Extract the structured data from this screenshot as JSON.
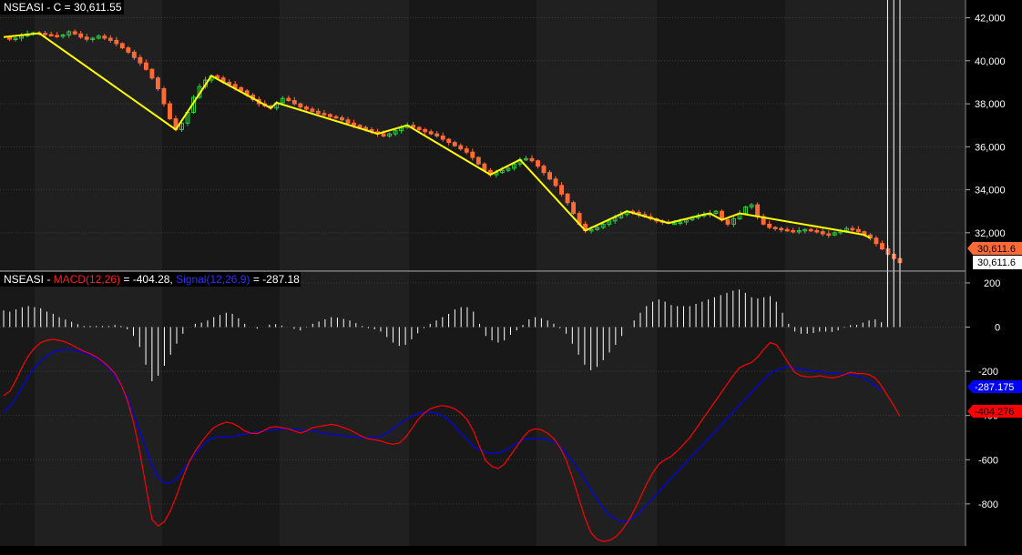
{
  "price_pane": {
    "title": "NSEASI - C = 30,611.55",
    "last_price_tag": "30,611.6",
    "last_price_tag_2": "30,611.6",
    "colors": {
      "up": "#2ecc40",
      "down": "#ff6a36",
      "zigzag": "#ffff00"
    }
  },
  "macd_pane": {
    "title_prefix": "NSEASI - ",
    "macd_label": "MACD(12,26)",
    "macd_value": " = -404.28, ",
    "signal_label": "Signal(12,26,9)",
    "signal_value": " = -287.18",
    "signal_tag": "-287.175",
    "macd_tag": "-404.276",
    "colors": {
      "macd": "#ff0000",
      "signal": "#0000ff",
      "histogram": "#ffffff"
    }
  },
  "chart_data": [
    {
      "type": "candlestick",
      "title": "NSEASI - C = 30,611.55",
      "y_ticks": [
        "42,000",
        "40,000",
        "38,000",
        "36,000",
        "34,000",
        "32,000"
      ],
      "ylim": [
        30300,
        42700
      ],
      "bars": 165,
      "closes": [
        41100,
        41000,
        41050,
        41150,
        41250,
        41300,
        41280,
        41220,
        41180,
        41150,
        41200,
        41350,
        41250,
        41100,
        41000,
        41050,
        41150,
        41050,
        40950,
        40800,
        40600,
        40400,
        40150,
        39900,
        39600,
        39200,
        38700,
        38000,
        37300,
        36800,
        37100,
        37600,
        38300,
        38800,
        39100,
        39300,
        39200,
        39000,
        38900,
        38750,
        38600,
        38400,
        38200,
        38000,
        37900,
        37800,
        38050,
        38250,
        38150,
        38000,
        37850,
        37750,
        37650,
        37550,
        37500,
        37400,
        37350,
        37250,
        37100,
        37000,
        36900,
        36800,
        36700,
        36600,
        36500,
        36600,
        36750,
        36900,
        37000,
        36900,
        36800,
        36700,
        36600,
        36500,
        36350,
        36200,
        36050,
        35900,
        35750,
        35500,
        35200,
        34900,
        34700,
        34800,
        34900,
        35000,
        35200,
        35400,
        35450,
        35350,
        35100,
        34800,
        34500,
        34200,
        33800,
        33400,
        32900,
        32400,
        32100,
        32150,
        32250,
        32400,
        32550,
        32700,
        32850,
        33000,
        32950,
        32850,
        32750,
        32650,
        32550,
        32500,
        32450,
        32450,
        32500,
        32600,
        32700,
        32800,
        32850,
        32900,
        33000,
        32600,
        32400,
        32650,
        32900,
        33200,
        33300,
        32750,
        32400,
        32250,
        32200,
        32150,
        32100,
        32050,
        32100,
        32150,
        32100,
        32050,
        31950,
        31900,
        32000,
        32100,
        32200,
        32150,
        32050,
        31900,
        31750,
        31500,
        31250,
        31000,
        30800,
        30611.55
      ],
      "zigzag_labels": []
    },
    {
      "type": "line",
      "title": "NSEASI - MACD(12,26) = -404.28, Signal(12,26,9) = -287.18",
      "y_ticks": [
        "200",
        "0",
        "-200",
        "-400",
        "-600",
        "-800"
      ],
      "ylim": [
        -990,
        245
      ],
      "series": [
        {
          "name": "MACD(12,26)",
          "values": [
            -310,
            -290,
            -240,
            -180,
            -130,
            -95,
            -70,
            -60,
            -55,
            -60,
            -68,
            -80,
            -95,
            -110,
            -120,
            -135,
            -155,
            -180,
            -210,
            -260,
            -330,
            -430,
            -560,
            -720,
            -870,
            -900,
            -880,
            -830,
            -760,
            -680,
            -610,
            -560,
            -520,
            -485,
            -455,
            -440,
            -430,
            -435,
            -450,
            -470,
            -480,
            -482,
            -470,
            -455,
            -450,
            -455,
            -460,
            -470,
            -480,
            -470,
            -455,
            -450,
            -445,
            -440,
            -445,
            -455,
            -465,
            -480,
            -495,
            -505,
            -510,
            -515,
            -525,
            -530,
            -525,
            -500,
            -460,
            -420,
            -390,
            -370,
            -360,
            -355,
            -360,
            -370,
            -390,
            -420,
            -470,
            -540,
            -605,
            -630,
            -640,
            -620,
            -580,
            -540,
            -500,
            -470,
            -460,
            -465,
            -480,
            -505,
            -545,
            -600,
            -680,
            -770,
            -860,
            -930,
            -960,
            -970,
            -965,
            -950,
            -920,
            -880,
            -830,
            -770,
            -710,
            -660,
            -620,
            -600,
            -585,
            -560,
            -530,
            -500,
            -460,
            -420,
            -380,
            -340,
            -300,
            -260,
            -220,
            -185,
            -170,
            -160,
            -135,
            -100,
            -70,
            -80,
            -120,
            -165,
            -205,
            -220,
            -225,
            -225,
            -220,
            -225,
            -230,
            -225,
            -215,
            -205,
            -210,
            -210,
            -215,
            -230,
            -265,
            -310,
            -355,
            -404.28
          ]
        },
        {
          "name": "Signal(12,26,9)",
          "values": [
            -385,
            -360,
            -320,
            -270,
            -225,
            -185,
            -155,
            -130,
            -115,
            -105,
            -102,
            -104,
            -108,
            -115,
            -125,
            -140,
            -160,
            -185,
            -220,
            -265,
            -320,
            -390,
            -470,
            -550,
            -625,
            -680,
            -705,
            -705,
            -685,
            -650,
            -610,
            -575,
            -540,
            -515,
            -500,
            -495,
            -495,
            -495,
            -490,
            -485,
            -480,
            -475,
            -470,
            -466,
            -463,
            -462,
            -460,
            -462,
            -465,
            -468,
            -470,
            -475,
            -480,
            -485,
            -488,
            -492,
            -495,
            -498,
            -500,
            -500,
            -500,
            -495,
            -480,
            -460,
            -440,
            -420,
            -405,
            -392,
            -385,
            -385,
            -390,
            -400,
            -420,
            -450,
            -480,
            -510,
            -540,
            -555,
            -565,
            -570,
            -570,
            -560,
            -545,
            -525,
            -510,
            -505,
            -505,
            -505,
            -510,
            -520,
            -540,
            -570,
            -605,
            -645,
            -690,
            -735,
            -780,
            -820,
            -850,
            -870,
            -880,
            -880,
            -860,
            -835,
            -805,
            -775,
            -745,
            -715,
            -685,
            -655,
            -625,
            -595,
            -565,
            -535,
            -505,
            -475,
            -445,
            -415,
            -385,
            -355,
            -325,
            -295,
            -265,
            -235,
            -210,
            -195,
            -185,
            -180,
            -185,
            -190,
            -195,
            -198,
            -200,
            -205,
            -208,
            -210,
            -212,
            -214,
            -220,
            -230,
            -245,
            -265,
            -287.18
          ]
        }
      ]
    }
  ]
}
